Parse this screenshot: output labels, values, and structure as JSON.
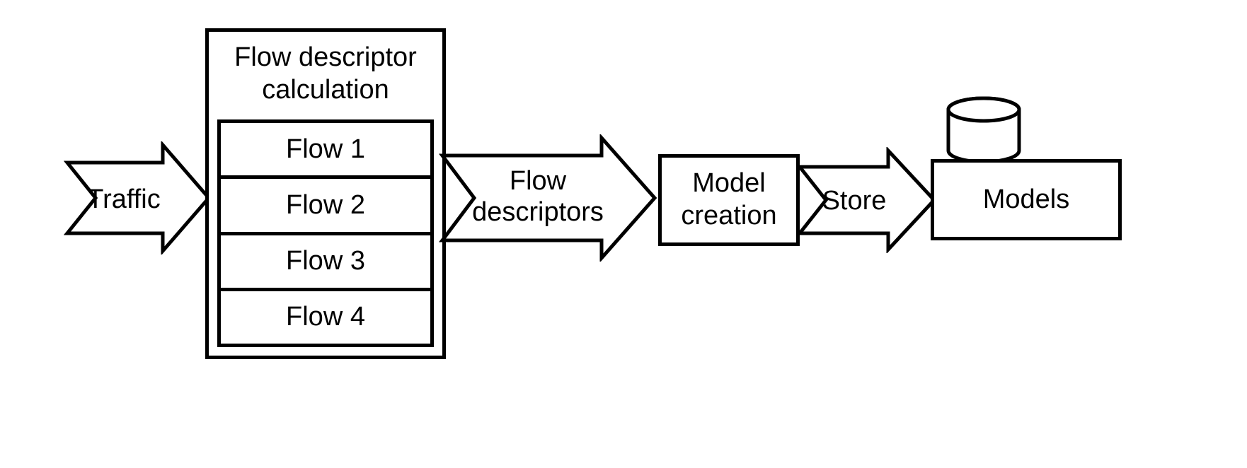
{
  "arrows": {
    "traffic": "Traffic",
    "flow_descriptors_line1": "Flow",
    "flow_descriptors_line2": "descriptors",
    "store": "Store"
  },
  "flow_box": {
    "title_line1": "Flow descriptor",
    "title_line2": "calculation",
    "rows": [
      "Flow 1",
      "Flow 2",
      "Flow 3",
      "Flow 4"
    ]
  },
  "boxes": {
    "model_creation_line1": "Model",
    "model_creation_line2": "creation",
    "models": "Models"
  }
}
